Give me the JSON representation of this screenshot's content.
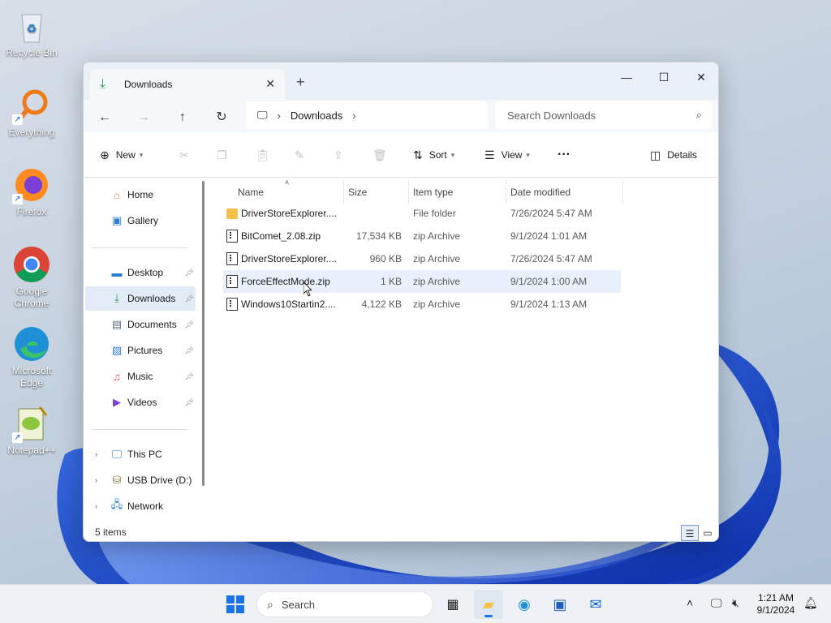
{
  "desktop": {
    "icons": [
      {
        "label": "Recycle Bin",
        "icon": "recycle-bin-icon"
      },
      {
        "label": "Everything",
        "icon": "everything-search-icon"
      },
      {
        "label": "Firefox",
        "icon": "firefox-icon"
      },
      {
        "label": "Google Chrome",
        "icon": "chrome-icon"
      },
      {
        "label": "Microsoft Edge",
        "icon": "edge-icon"
      },
      {
        "label": "Notepad++",
        "icon": "notepadpp-icon"
      }
    ]
  },
  "window": {
    "tab_title": "Downloads",
    "tab_close": "✕",
    "new_tab": "+",
    "controls": {
      "minimize": "—",
      "maximize": "☐",
      "close": "✕"
    }
  },
  "nav": {
    "back": "←",
    "forward": "→",
    "up": "↑",
    "refresh": "↻",
    "breadcrumb": "Downloads",
    "search_placeholder": "Search Downloads"
  },
  "commands": {
    "new": "New",
    "sort": "Sort",
    "view": "View",
    "more": "···",
    "details": "Details"
  },
  "sidebar": {
    "quick": [
      {
        "label": "Home",
        "icon": "home-icon"
      },
      {
        "label": "Gallery",
        "icon": "gallery-icon"
      }
    ],
    "pinned": [
      {
        "label": "Desktop",
        "icon": "desktop-icon"
      },
      {
        "label": "Downloads",
        "icon": "downloads-icon",
        "selected": true
      },
      {
        "label": "Documents",
        "icon": "documents-icon"
      },
      {
        "label": "Pictures",
        "icon": "pictures-icon"
      },
      {
        "label": "Music",
        "icon": "music-icon"
      },
      {
        "label": "Videos",
        "icon": "videos-icon"
      }
    ],
    "drives": [
      {
        "label": "This PC",
        "icon": "this-pc-icon"
      },
      {
        "label": "USB Drive (D:)",
        "icon": "usb-drive-icon"
      },
      {
        "label": "Network",
        "icon": "network-icon"
      }
    ]
  },
  "files": {
    "columns": {
      "name": "Name",
      "size": "Size",
      "type": "Item type",
      "date": "Date modified"
    },
    "rows": [
      {
        "name": "DriverStoreExplorer....",
        "size": "",
        "type": "File folder",
        "date": "7/26/2024 5:47 AM",
        "icon": "folder-icon"
      },
      {
        "name": "BitComet_2.08.zip",
        "size": "17,534 KB",
        "type": "zip Archive",
        "date": "9/1/2024 1:01 AM",
        "icon": "zip-icon"
      },
      {
        "name": "DriverStoreExplorer....",
        "size": "960 KB",
        "type": "zip Archive",
        "date": "7/26/2024 5:47 AM",
        "icon": "zip-icon"
      },
      {
        "name": "ForceEffectMode.zip",
        "size": "1 KB",
        "type": "zip Archive",
        "date": "9/1/2024 1:00 AM",
        "icon": "zip-icon",
        "hover": true
      },
      {
        "name": "Windows10Startin2....",
        "size": "4,122 KB",
        "type": "zip Archive",
        "date": "9/1/2024 1:13 AM",
        "icon": "zip-icon"
      }
    ]
  },
  "status": {
    "item_count": "5 items"
  },
  "taskbar": {
    "search_label": "Search",
    "time": "1:21 AM",
    "date": "9/1/2024"
  },
  "colors": {
    "accent": "#1a73e8",
    "selection": "#e3ecf6",
    "hover": "#e8f1fb",
    "folder": "#f4c04a"
  }
}
